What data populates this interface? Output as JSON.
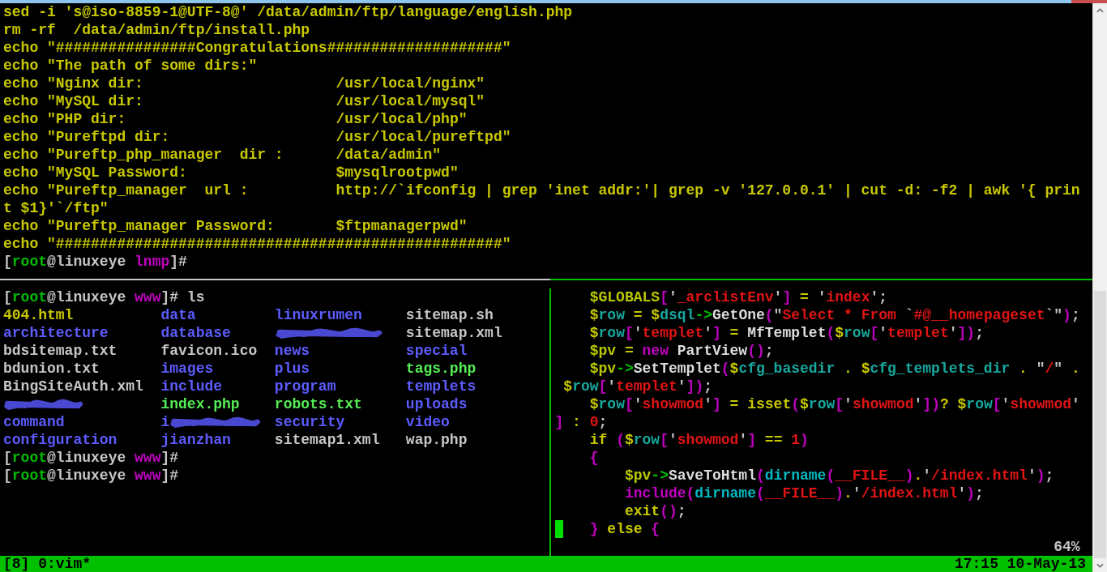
{
  "top_pane": {
    "lines": [
      "sed -i 's@iso-8859-1@UTF-8@' /data/admin/ftp/language/english.php",
      "rm -rf  /data/admin/ftp/install.php",
      "echo \"################Congratulations####################\"",
      "echo \"The path of some dirs:\"",
      "echo \"Nginx dir:                      /usr/local/nginx\"",
      "echo \"MySQL dir:                      /usr/local/mysql\"",
      "echo \"PHP dir:                        /usr/local/php\"",
      "echo \"Pureftpd dir:                   /usr/local/pureftpd\"",
      "echo \"Pureftp_php_manager  dir :      /data/admin\"",
      "echo \"MySQL Password:                 $mysqlrootpwd\"",
      "echo \"Pureftp_manager  url :          http://`ifconfig | grep 'inet addr:'| grep -v '127.0.0.1' | cut -d: -f2 | awk '{ prin",
      "t $1}'`/ftp\"",
      "echo \"Pureftp_manager Password:       $ftpmanagerpwd\"",
      "echo \"###################################################\""
    ],
    "prompt": [
      {
        "text": "[",
        "kind": "plain"
      },
      {
        "text": "root",
        "kind": "user"
      },
      {
        "text": "@linuxeye ",
        "kind": "plain"
      },
      {
        "text": "lnmp",
        "kind": "cwd"
      },
      {
        "text": "]#",
        "kind": "plain"
      }
    ]
  },
  "left_pane": {
    "lines": [
      {
        "kind": "prompt",
        "segments": [
          {
            "text": "[",
            "kind": "plain"
          },
          {
            "text": "root",
            "kind": "user"
          },
          {
            "text": "@linuxeye ",
            "kind": "plain"
          },
          {
            "text": "www",
            "kind": "cwd"
          },
          {
            "text": "]# ls",
            "kind": "plain"
          }
        ]
      },
      {
        "kind": "listing",
        "entries": [
          {
            "text": "404.html",
            "kind": "other",
            "redacted": false
          },
          {
            "text": "data",
            "kind": "directory",
            "redacted": false
          },
          {
            "text": "linuxrumen",
            "kind": "directory",
            "redacted": false
          },
          {
            "text": "sitemap.sh",
            "kind": "file",
            "redacted": false
          }
        ]
      },
      {
        "kind": "listing",
        "entries": [
          {
            "text": "architecture",
            "kind": "directory",
            "redacted": false
          },
          {
            "text": "database",
            "kind": "directory",
            "redacted": false
          },
          {
            "redacted": true
          },
          {
            "text": "sitemap.xml",
            "kind": "file",
            "redacted": false
          }
        ]
      },
      {
        "kind": "listing",
        "entries": [
          {
            "text": "bdsitemap.txt",
            "kind": "file",
            "redacted": false
          },
          {
            "text": "favicon.ico",
            "kind": "file",
            "redacted": false
          },
          {
            "text": "news",
            "kind": "directory",
            "redacted": false
          },
          {
            "text": "special",
            "kind": "directory",
            "redacted": false
          }
        ]
      },
      {
        "kind": "listing",
        "entries": [
          {
            "text": "bdunion.txt",
            "kind": "file",
            "redacted": false
          },
          {
            "text": "images",
            "kind": "directory",
            "redacted": false
          },
          {
            "text": "plus",
            "kind": "directory",
            "redacted": false
          },
          {
            "text": "tags.php",
            "kind": "executable",
            "redacted": false
          }
        ]
      },
      {
        "kind": "listing",
        "entries": [
          {
            "text": "BingSiteAuth.xml",
            "kind": "file",
            "redacted": false
          },
          {
            "text": "include",
            "kind": "directory",
            "redacted": false
          },
          {
            "text": "program",
            "kind": "directory",
            "redacted": false
          },
          {
            "text": "templets",
            "kind": "directory",
            "redacted": false
          }
        ]
      },
      {
        "kind": "listing",
        "entries": [
          {
            "redacted": true
          },
          {
            "text": "index.php",
            "kind": "executable",
            "redacted": false
          },
          {
            "text": "robots.txt",
            "kind": "executable",
            "redacted": false
          },
          {
            "text": "uploads",
            "kind": "directory",
            "redacted": false
          }
        ]
      },
      {
        "kind": "listing",
        "entries": [
          {
            "text": "command",
            "kind": "directory",
            "redacted": false
          },
          {
            "text": "i",
            "kind": "directory",
            "redacted": true
          },
          {
            "text": "security",
            "kind": "directory",
            "redacted": false
          },
          {
            "text": "video",
            "kind": "directory",
            "redacted": false
          }
        ]
      },
      {
        "kind": "listing",
        "entries": [
          {
            "text": "configuration",
            "kind": "directory",
            "redacted": false
          },
          {
            "text": "jianzhan",
            "kind": "directory",
            "redacted": false
          },
          {
            "text": "sitemap1.xml",
            "kind": "file",
            "redacted": false
          },
          {
            "text": "wap.php",
            "kind": "file",
            "redacted": false
          }
        ]
      },
      {
        "kind": "prompt",
        "segments": [
          {
            "text": "[",
            "kind": "plain"
          },
          {
            "text": "root",
            "kind": "user"
          },
          {
            "text": "@linuxeye ",
            "kind": "plain"
          },
          {
            "text": "www",
            "kind": "cwd"
          },
          {
            "text": "]#",
            "kind": "plain"
          }
        ]
      },
      {
        "kind": "prompt",
        "segments": [
          {
            "text": "[",
            "kind": "plain"
          },
          {
            "text": "root",
            "kind": "user"
          },
          {
            "text": "@linuxeye ",
            "kind": "plain"
          },
          {
            "text": "www",
            "kind": "cwd"
          },
          {
            "text": "]#",
            "kind": "plain"
          }
        ]
      }
    ]
  },
  "vim_pane": {
    "lines": [
      {
        "cursor": false,
        "tokens": [
          {
            "text": "    $GLOBALS",
            "kind": "global"
          },
          {
            "text": "[",
            "kind": "bracket"
          },
          {
            "text": "'",
            "kind": "plain"
          },
          {
            "text": "_arclistEnv",
            "kind": "string"
          },
          {
            "text": "'",
            "kind": "plain"
          },
          {
            "text": "]",
            "kind": "bracket"
          },
          {
            "text": " = ",
            "kind": "op"
          },
          {
            "text": "'",
            "kind": "plain"
          },
          {
            "text": "index",
            "kind": "string"
          },
          {
            "text": "';",
            "kind": "plain"
          }
        ]
      },
      {
        "cursor": false,
        "tokens": [
          {
            "text": "    $",
            "kind": "sigil"
          },
          {
            "text": "row",
            "kind": "var"
          },
          {
            "text": " = ",
            "kind": "op"
          },
          {
            "text": "$",
            "kind": "sigil"
          },
          {
            "text": "dsql",
            "kind": "var"
          },
          {
            "text": "->",
            "kind": "arrow"
          },
          {
            "text": "GetOne",
            "kind": "func"
          },
          {
            "text": "(",
            "kind": "bracket"
          },
          {
            "text": "\"",
            "kind": "plain"
          },
          {
            "text": "Select * From ",
            "kind": "string"
          },
          {
            "text": "`",
            "kind": "plain"
          },
          {
            "text": "#@__homepageset",
            "kind": "string"
          },
          {
            "text": "`\"",
            "kind": "plain"
          },
          {
            "text": ")",
            "kind": "bracket"
          },
          {
            "text": ";",
            "kind": "plain"
          }
        ]
      },
      {
        "cursor": false,
        "tokens": [
          {
            "text": "    $",
            "kind": "sigil"
          },
          {
            "text": "row",
            "kind": "var"
          },
          {
            "text": "[",
            "kind": "bracket"
          },
          {
            "text": "'",
            "kind": "plain"
          },
          {
            "text": "templet",
            "kind": "string"
          },
          {
            "text": "'",
            "kind": "plain"
          },
          {
            "text": "]",
            "kind": "bracket"
          },
          {
            "text": " = ",
            "kind": "op"
          },
          {
            "text": "MfTemplet",
            "kind": "func"
          },
          {
            "text": "(",
            "kind": "bracket"
          },
          {
            "text": "$",
            "kind": "sigil"
          },
          {
            "text": "row",
            "kind": "var"
          },
          {
            "text": "[",
            "kind": "bracket"
          },
          {
            "text": "'",
            "kind": "plain"
          },
          {
            "text": "templet",
            "kind": "string"
          },
          {
            "text": "'",
            "kind": "plain"
          },
          {
            "text": "])",
            "kind": "bracket"
          },
          {
            "text": ";",
            "kind": "plain"
          }
        ]
      },
      {
        "cursor": false,
        "tokens": [
          {
            "text": "    $pv",
            "kind": "global"
          },
          {
            "text": " = ",
            "kind": "op"
          },
          {
            "text": "new ",
            "kind": "keyword"
          },
          {
            "text": "PartView",
            "kind": "func"
          },
          {
            "text": "()",
            "kind": "bracket"
          },
          {
            "text": ";",
            "kind": "plain"
          }
        ]
      },
      {
        "cursor": false,
        "tokens": [
          {
            "text": "    $pv",
            "kind": "global"
          },
          {
            "text": "->",
            "kind": "arrow"
          },
          {
            "text": "SetTemplet",
            "kind": "func"
          },
          {
            "text": "(",
            "kind": "bracket"
          },
          {
            "text": "$",
            "kind": "sigil"
          },
          {
            "text": "cfg_basedir",
            "kind": "var"
          },
          {
            "text": " . ",
            "kind": "op"
          },
          {
            "text": "$",
            "kind": "sigil"
          },
          {
            "text": "cfg_templets_dir",
            "kind": "var"
          },
          {
            "text": " . ",
            "kind": "op"
          },
          {
            "text": "\"",
            "kind": "plain"
          },
          {
            "text": "/",
            "kind": "string"
          },
          {
            "text": "\"",
            "kind": "plain"
          },
          {
            "text": " .",
            "kind": "op"
          }
        ]
      },
      {
        "cursor": false,
        "tokens": [
          {
            "text": " $",
            "kind": "sigil"
          },
          {
            "text": "row",
            "kind": "var"
          },
          {
            "text": "[",
            "kind": "bracket"
          },
          {
            "text": "'",
            "kind": "plain"
          },
          {
            "text": "templet",
            "kind": "string"
          },
          {
            "text": "'",
            "kind": "plain"
          },
          {
            "text": "])",
            "kind": "bracket"
          },
          {
            "text": ";",
            "kind": "plain"
          }
        ]
      },
      {
        "cursor": false,
        "tokens": [
          {
            "text": "    $",
            "kind": "sigil"
          },
          {
            "text": "row",
            "kind": "var"
          },
          {
            "text": "[",
            "kind": "bracket"
          },
          {
            "text": "'",
            "kind": "plain"
          },
          {
            "text": "showmod",
            "kind": "string"
          },
          {
            "text": "'",
            "kind": "plain"
          },
          {
            "text": "]",
            "kind": "bracket"
          },
          {
            "text": " = ",
            "kind": "op"
          },
          {
            "text": "isset",
            "kind": "builtin"
          },
          {
            "text": "(",
            "kind": "bracket"
          },
          {
            "text": "$",
            "kind": "sigil"
          },
          {
            "text": "row",
            "kind": "var"
          },
          {
            "text": "[",
            "kind": "bracket"
          },
          {
            "text": "'",
            "kind": "plain"
          },
          {
            "text": "showmod",
            "kind": "string"
          },
          {
            "text": "'",
            "kind": "plain"
          },
          {
            "text": "])",
            "kind": "bracket"
          },
          {
            "text": "? ",
            "kind": "op"
          },
          {
            "text": "$",
            "kind": "sigil"
          },
          {
            "text": "row",
            "kind": "var"
          },
          {
            "text": "[",
            "kind": "bracket"
          },
          {
            "text": "'",
            "kind": "plain"
          },
          {
            "text": "showmod",
            "kind": "string"
          },
          {
            "text": "'",
            "kind": "plain"
          }
        ]
      },
      {
        "cursor": false,
        "tokens": [
          {
            "text": "]",
            "kind": "bracket"
          },
          {
            "text": " : ",
            "kind": "op"
          },
          {
            "text": "0",
            "kind": "number"
          },
          {
            "text": ";",
            "kind": "plain"
          }
        ]
      },
      {
        "cursor": false,
        "tokens": [
          {
            "text": "    if ",
            "kind": "builtin"
          },
          {
            "text": "(",
            "kind": "bracket"
          },
          {
            "text": "$",
            "kind": "sigil"
          },
          {
            "text": "row",
            "kind": "var"
          },
          {
            "text": "[",
            "kind": "bracket"
          },
          {
            "text": "'",
            "kind": "plain"
          },
          {
            "text": "showmod",
            "kind": "string"
          },
          {
            "text": "'",
            "kind": "plain"
          },
          {
            "text": "]",
            "kind": "bracket"
          },
          {
            "text": " == ",
            "kind": "op"
          },
          {
            "text": "1",
            "kind": "number"
          },
          {
            "text": ")",
            "kind": "bracket"
          }
        ]
      },
      {
        "cursor": false,
        "tokens": [
          {
            "text": "    {",
            "kind": "bracket"
          }
        ]
      },
      {
        "cursor": false,
        "tokens": [
          {
            "text": "        $pv",
            "kind": "global"
          },
          {
            "text": "->",
            "kind": "arrow"
          },
          {
            "text": "SaveToHtml",
            "kind": "func"
          },
          {
            "text": "(",
            "kind": "bracket"
          },
          {
            "text": "dirname",
            "kind": "cfunc"
          },
          {
            "text": "(",
            "kind": "bracket"
          },
          {
            "text": "__FILE__",
            "kind": "string"
          },
          {
            "text": ")",
            "kind": "bracket"
          },
          {
            "text": ".",
            "kind": "op"
          },
          {
            "text": "'",
            "kind": "plain"
          },
          {
            "text": "/index.html",
            "kind": "string"
          },
          {
            "text": "'",
            "kind": "plain"
          },
          {
            "text": ")",
            "kind": "bracket"
          },
          {
            "text": ";",
            "kind": "plain"
          }
        ]
      },
      {
        "cursor": false,
        "tokens": [
          {
            "text": "        include",
            "kind": "keyword"
          },
          {
            "text": "(",
            "kind": "bracket"
          },
          {
            "text": "dirname",
            "kind": "cfunc"
          },
          {
            "text": "(",
            "kind": "bracket"
          },
          {
            "text": "__FILE__",
            "kind": "string"
          },
          {
            "text": ")",
            "kind": "bracket"
          },
          {
            "text": ".",
            "kind": "op"
          },
          {
            "text": "'",
            "kind": "plain"
          },
          {
            "text": "/index.html",
            "kind": "string"
          },
          {
            "text": "'",
            "kind": "plain"
          },
          {
            "text": ")",
            "kind": "bracket"
          },
          {
            "text": ";",
            "kind": "plain"
          }
        ]
      },
      {
        "cursor": false,
        "tokens": [
          {
            "text": "        exit",
            "kind": "builtin"
          },
          {
            "text": "()",
            "kind": "bracket"
          },
          {
            "text": ";",
            "kind": "plain"
          }
        ]
      },
      {
        "cursor": true,
        "tokens": [
          {
            "text": "    } ",
            "kind": "bracket"
          },
          {
            "text": "else ",
            "kind": "builtin"
          },
          {
            "text": "{",
            "kind": "bracket"
          }
        ]
      }
    ],
    "ruler": "64%"
  },
  "status_bar": {
    "session": "[8]",
    "window": "0:vim*",
    "clock": "17:15 10-May-13"
  }
}
